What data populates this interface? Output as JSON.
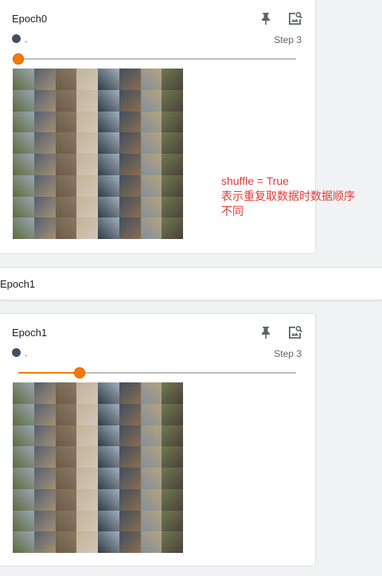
{
  "cards": [
    {
      "title": "Epoch0",
      "run": ".",
      "step": "Step 3",
      "slider_fraction": 0.0,
      "run_color": "#425066",
      "seed": 7
    },
    {
      "title": "Epoch1",
      "run": ".",
      "step": "Step 3",
      "slider_fraction": 0.22,
      "run_color": "#425066",
      "seed": 23
    }
  ],
  "group": {
    "title": "Epoch1"
  },
  "annotation": {
    "line1": "shuffle = True",
    "line2": "表示重复取数据时数据顺序",
    "line3": "不同"
  },
  "colors": {
    "accent": "#f57c00",
    "annotation": "#e53935"
  },
  "icons": [
    "pin-icon",
    "image-search-icon"
  ]
}
